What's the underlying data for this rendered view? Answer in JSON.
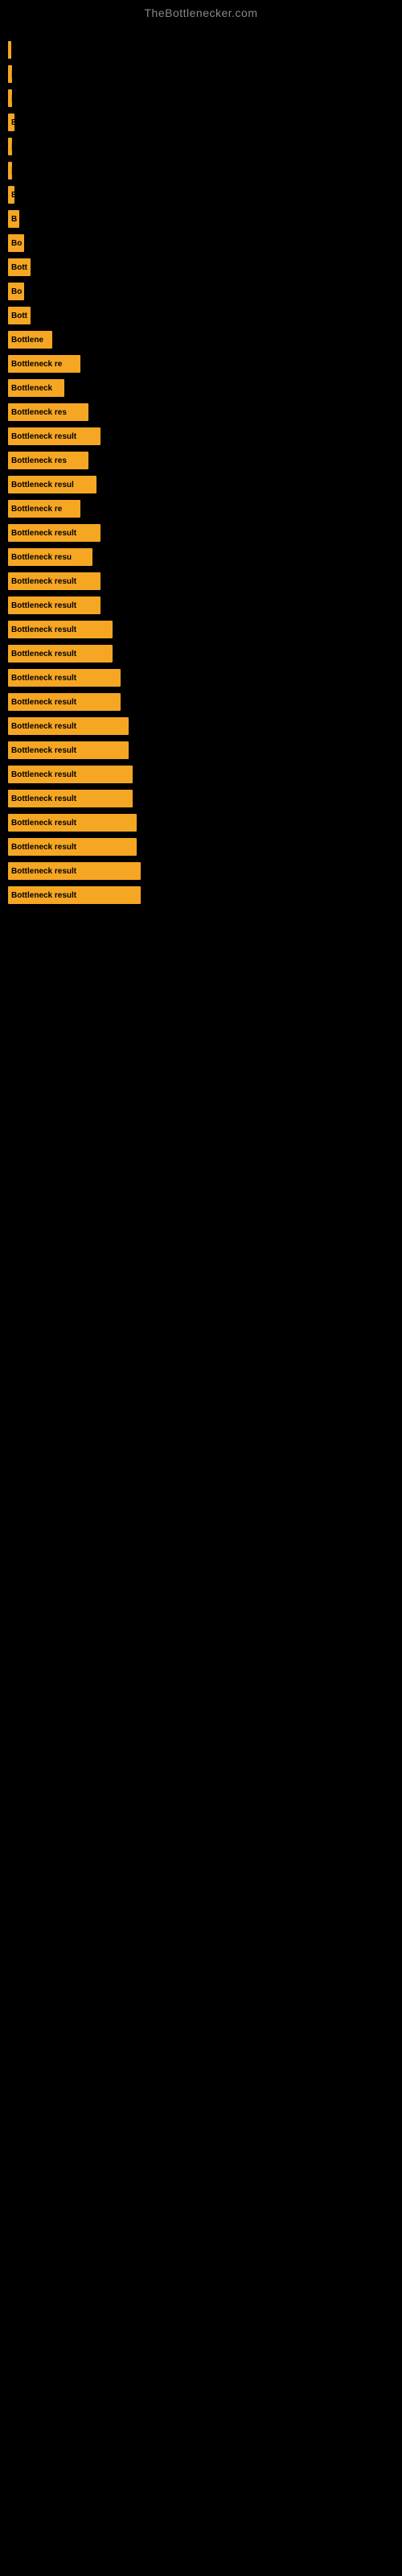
{
  "site": {
    "title": "TheBottlenecker.com"
  },
  "bars": [
    {
      "label": "|",
      "width": 4
    },
    {
      "label": "|",
      "width": 5
    },
    {
      "label": "|",
      "width": 5
    },
    {
      "label": "E",
      "width": 8
    },
    {
      "label": "|",
      "width": 5
    },
    {
      "label": "|",
      "width": 5
    },
    {
      "label": "E",
      "width": 8
    },
    {
      "label": "B",
      "width": 14
    },
    {
      "label": "Bo",
      "width": 20
    },
    {
      "label": "Bott",
      "width": 28
    },
    {
      "label": "Bo",
      "width": 20
    },
    {
      "label": "Bott",
      "width": 28
    },
    {
      "label": "Bottlene",
      "width": 55
    },
    {
      "label": "Bottleneck re",
      "width": 90
    },
    {
      "label": "Bottleneck",
      "width": 70
    },
    {
      "label": "Bottleneck res",
      "width": 100
    },
    {
      "label": "Bottleneck result",
      "width": 115
    },
    {
      "label": "Bottleneck res",
      "width": 100
    },
    {
      "label": "Bottleneck resul",
      "width": 110
    },
    {
      "label": "Bottleneck re",
      "width": 90
    },
    {
      "label": "Bottleneck result",
      "width": 115
    },
    {
      "label": "Bottleneck resu",
      "width": 105
    },
    {
      "label": "Bottleneck result",
      "width": 115
    },
    {
      "label": "Bottleneck result",
      "width": 115
    },
    {
      "label": "Bottleneck result",
      "width": 130
    },
    {
      "label": "Bottleneck result",
      "width": 130
    },
    {
      "label": "Bottleneck result",
      "width": 140
    },
    {
      "label": "Bottleneck result",
      "width": 140
    },
    {
      "label": "Bottleneck result",
      "width": 150
    },
    {
      "label": "Bottleneck result",
      "width": 150
    },
    {
      "label": "Bottleneck result",
      "width": 155
    },
    {
      "label": "Bottleneck result",
      "width": 155
    },
    {
      "label": "Bottleneck result",
      "width": 160
    },
    {
      "label": "Bottleneck result",
      "width": 160
    },
    {
      "label": "Bottleneck result",
      "width": 165
    },
    {
      "label": "Bottleneck result",
      "width": 165
    }
  ]
}
